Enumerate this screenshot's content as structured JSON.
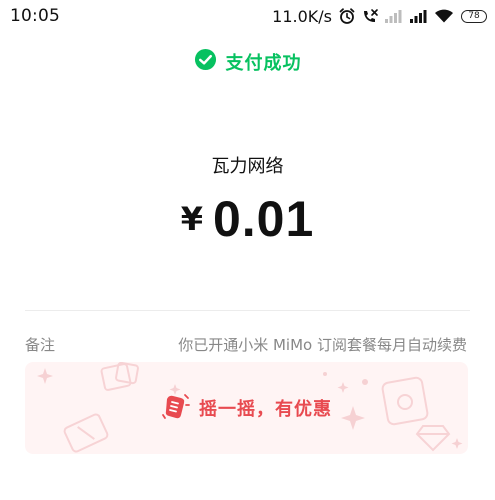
{
  "status_bar": {
    "time": "10:05",
    "net_speed": "11.0K/s",
    "battery": "78",
    "icons": [
      "alarm-icon",
      "call-missed-icon",
      "signal-weak-icon",
      "signal-strong-icon",
      "wifi-icon",
      "battery-icon"
    ]
  },
  "payment": {
    "status_text": "支付成功",
    "merchant": "瓦力网络",
    "currency_symbol": "¥",
    "amount": "0.01"
  },
  "remark": {
    "label": "备注",
    "value": "你已开通小米 MiMo 订阅套餐每月自动续费"
  },
  "promo": {
    "text": "摇一摇，有优惠"
  },
  "colors": {
    "success_green": "#07c160",
    "promo_red": "#e84a50",
    "promo_bg": "#fff4f4"
  }
}
